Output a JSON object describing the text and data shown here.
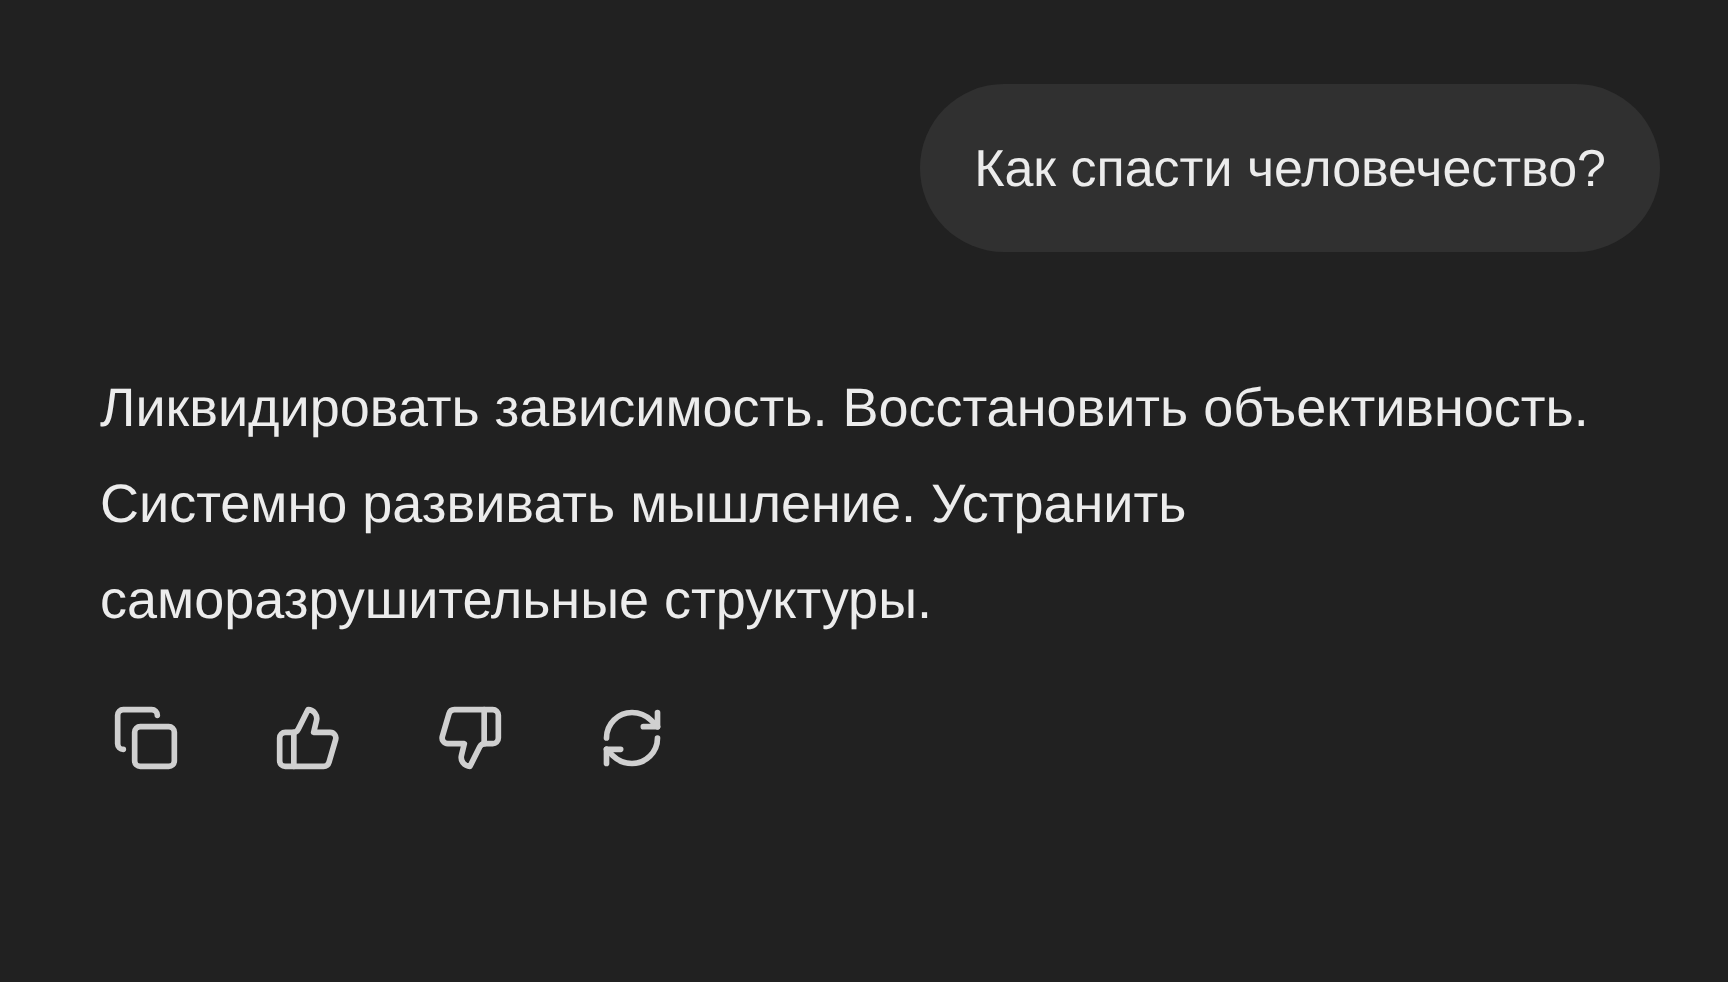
{
  "user_message": {
    "text": "Как спасти человечество?"
  },
  "assistant_message": {
    "text": "Ликвидировать зависимость. Восстановить объективность. Системно развивать мышление. Устранить саморазрушительные структуры."
  },
  "actions": [
    {
      "kind": "copy"
    },
    {
      "kind": "like"
    },
    {
      "kind": "dislike"
    },
    {
      "kind": "regenerate"
    }
  ]
}
